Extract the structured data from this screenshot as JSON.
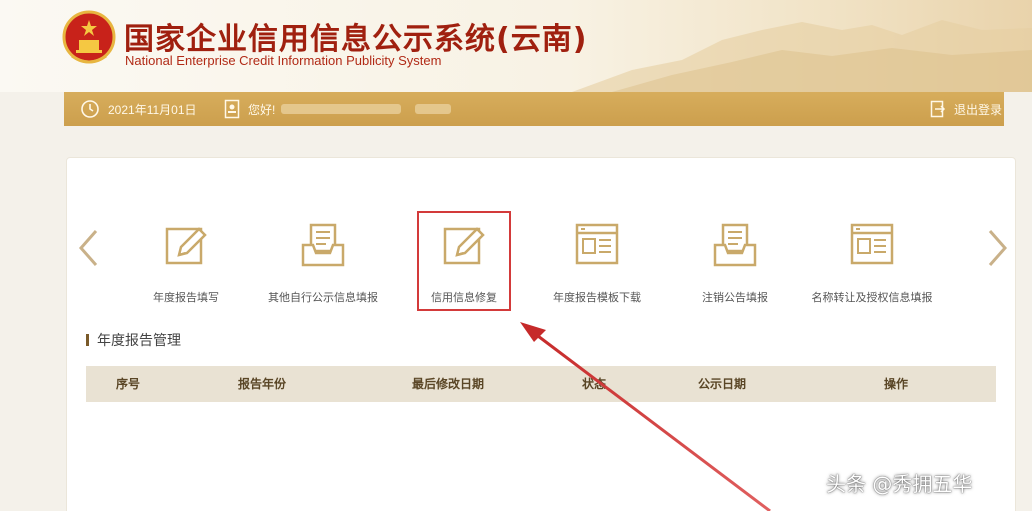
{
  "header": {
    "title": "国家企业信用信息公示系统(云南)",
    "subtitle": "National Enterprise Credit Information Publicity System"
  },
  "toolbar": {
    "date": "2021年11月01日",
    "user_prefix": "您好!",
    "logout_label": "退出登录"
  },
  "functions": [
    {
      "label": "年度报告填写",
      "icon": "pencil-edit-icon"
    },
    {
      "label": "其他自行公示信息填报",
      "icon": "inbox-document-icon"
    },
    {
      "label": "信用信息修复",
      "icon": "pencil-edit-icon",
      "highlighted": true
    },
    {
      "label": "年度报告模板下载",
      "icon": "template-window-icon"
    },
    {
      "label": "注销公告填报",
      "icon": "inbox-document-icon"
    },
    {
      "label": "名称转让及授权信息填报",
      "icon": "template-window-icon"
    }
  ],
  "section": {
    "title": "年度报告管理"
  },
  "table": {
    "columns": [
      "序号",
      "报告年份",
      "最后修改日期",
      "状态",
      "公示日期",
      "操作"
    ]
  },
  "watermark": "头条 @秀拥五华",
  "colors": {
    "brand_red": "#a0200f",
    "gold_bar": "#d7ad5c",
    "icon_gold": "#c9a96a",
    "highlight_red": "#d33a3a"
  }
}
